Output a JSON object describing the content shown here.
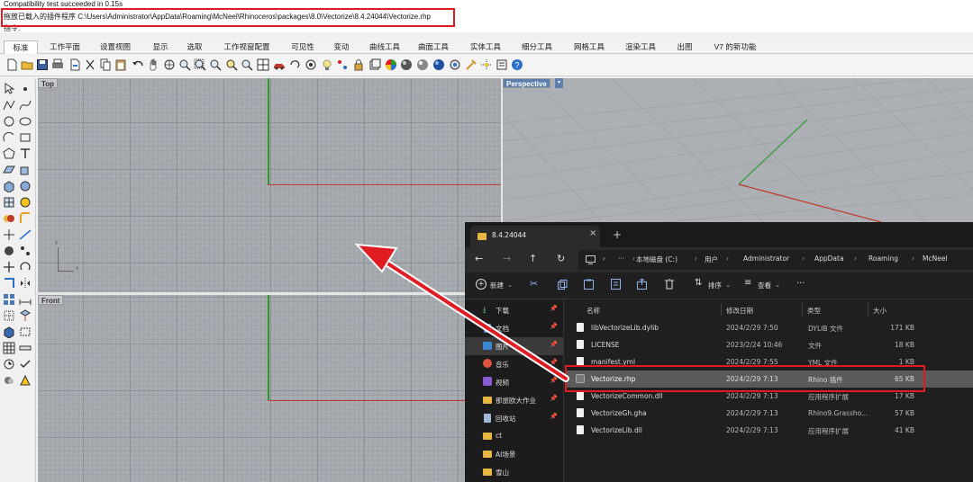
{
  "command_area": {
    "line1": "Compatibility test succeeded in 0.15s",
    "line2": "拖放已载入的插件程序 C:\\Users\\Administrator\\AppData\\Roaming\\McNeel\\Rhinoceros\\packages\\8.0\\Vectorize\\8.4.24044\\Vectorize.rhp",
    "line3": "指令:"
  },
  "ribbon_tabs": [
    "标准",
    "工作平面",
    "设置视图",
    "显示",
    "选取",
    "工作视窗配置",
    "可见性",
    "变动",
    "曲线工具",
    "曲面工具",
    "实体工具",
    "细分工具",
    "网格工具",
    "渲染工具",
    "出图",
    "V7 的新功能"
  ],
  "viewports": {
    "top_label": "Top",
    "perspective_label": "Perspective",
    "front_label": "Front",
    "axis_x_label": "x",
    "axis_y_label": "y"
  },
  "explorer": {
    "tab_title": "8.4.24044",
    "new_tab": "+",
    "close_tab": "×",
    "breadcrumb": [
      "本地磁盘 (C:)",
      "用户",
      "Administrator",
      "AppData",
      "Roaming",
      "McNeel"
    ],
    "toolbar": {
      "new_label": "新建",
      "sort_label": "排序",
      "view_label": "查看",
      "more_label": "···"
    },
    "sidebar": [
      {
        "label": "下载",
        "icon": "download-icon",
        "pinned": true
      },
      {
        "label": "文档",
        "icon": "document-icon",
        "pinned": true
      },
      {
        "label": "图片",
        "icon": "picture-icon",
        "pinned": true
      },
      {
        "label": "音乐",
        "icon": "music-icon",
        "pinned": true
      },
      {
        "label": "视频",
        "icon": "video-icon",
        "pinned": true
      },
      {
        "label": "那旅欧大作业",
        "icon": "folder-icon",
        "pinned": true
      },
      {
        "label": "回收站",
        "icon": "recycle-bin-icon",
        "pinned": true
      },
      {
        "label": "ct",
        "icon": "folder-icon",
        "pinned": false
      },
      {
        "label": "AI场景",
        "icon": "folder-icon",
        "pinned": false
      },
      {
        "label": "雪山",
        "icon": "folder-icon",
        "pinned": false
      }
    ],
    "columns": {
      "name": "名称",
      "date": "修改日期",
      "type": "类型",
      "size": "大小"
    },
    "files": [
      {
        "name": "libVectorizeLib.dylib",
        "date": "2024/2/29 7:50",
        "type": "DYLIB 文件",
        "size": "171 KB"
      },
      {
        "name": "LICENSE",
        "date": "2023/2/24 10:46",
        "type": "文件",
        "size": "18 KB"
      },
      {
        "name": "manifest.yml",
        "date": "2024/2/29 7:55",
        "type": "YML 文件",
        "size": "1 KB"
      },
      {
        "name": "Vectorize.rhp",
        "date": "2024/2/29 7:13",
        "type": "Rhino 插件",
        "size": "65 KB"
      },
      {
        "name": "VectorizeCommon.dll",
        "date": "2024/2/29 7:13",
        "type": "应用程序扩展",
        "size": "17 KB"
      },
      {
        "name": "VectorizeGh.gha",
        "date": "2024/2/29 7:13",
        "type": "Rhino9.Grassho...",
        "size": "57 KB"
      },
      {
        "name": "VectorizeLib.dll",
        "date": "2024/2/29 7:13",
        "type": "应用程序扩展",
        "size": "41 KB"
      }
    ]
  },
  "colors": {
    "highlight_red": "#e11b22",
    "axis_green": "#2c9a2c",
    "axis_red": "#c0392b",
    "folder_yellow": "#e8b741"
  }
}
